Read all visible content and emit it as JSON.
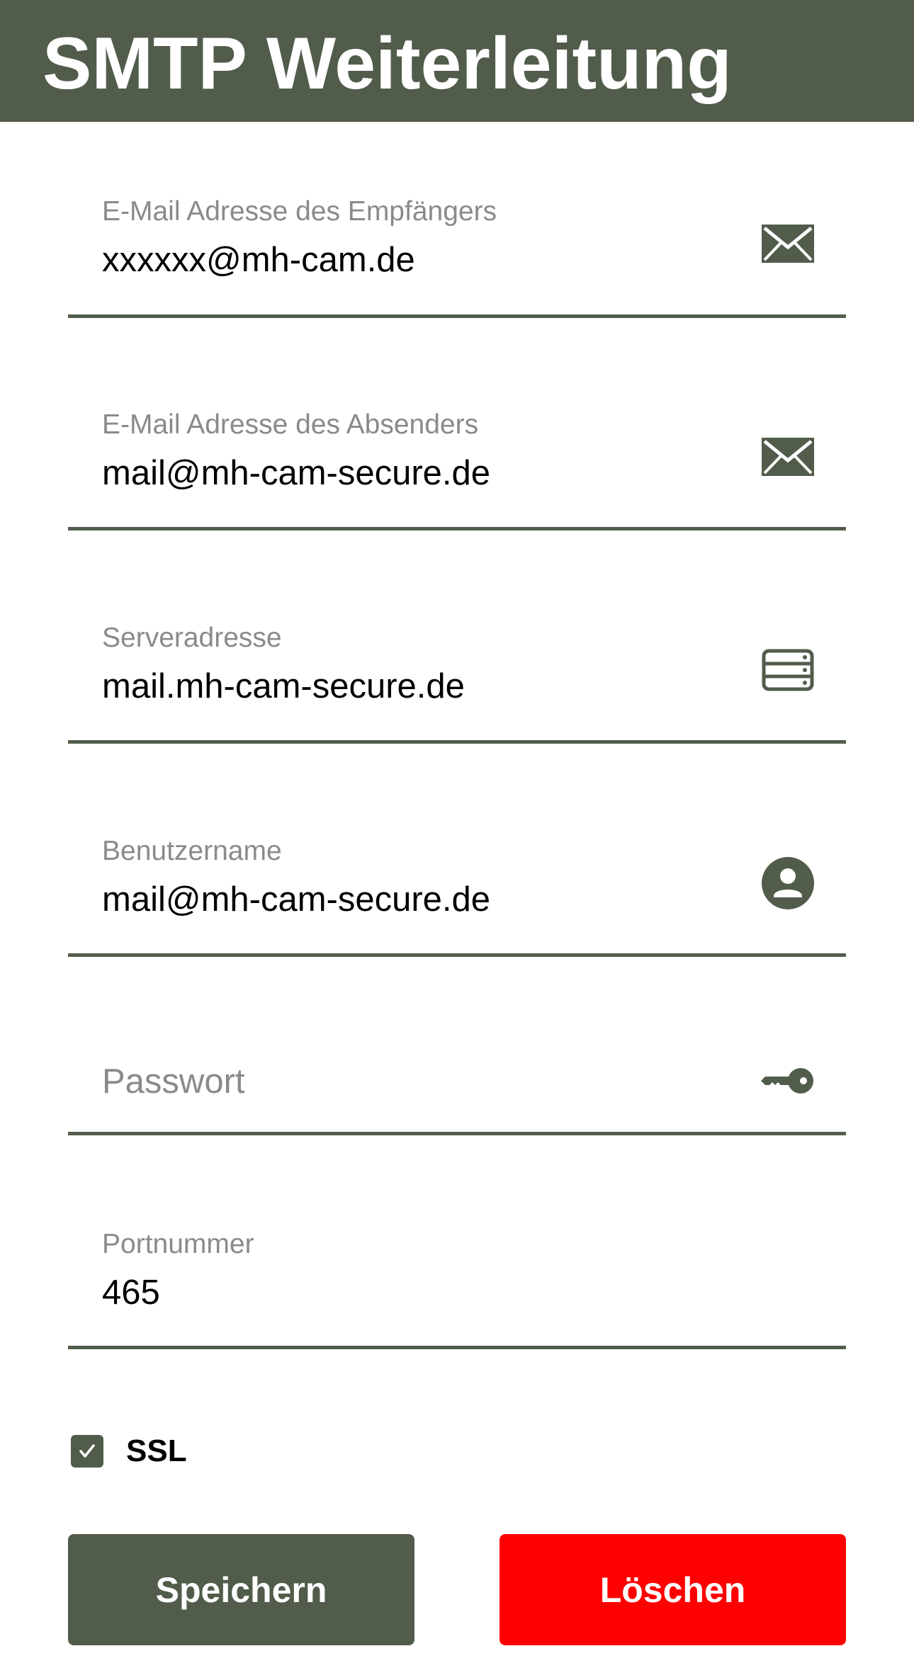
{
  "header": {
    "title": "SMTP Weiterleitung"
  },
  "fields": {
    "recipient": {
      "label": "E-Mail Adresse des Empfängers",
      "value": "xxxxxx@mh-cam.de",
      "icon": "envelope-icon"
    },
    "sender": {
      "label": "E-Mail Adresse des Absenders",
      "value": "mail@mh-cam-secure.de",
      "icon": "envelope-icon"
    },
    "server": {
      "label": "Serveradresse",
      "value": "mail.mh-cam-secure.de",
      "icon": "server-icon"
    },
    "username": {
      "label": "Benutzername",
      "value": "mail@mh-cam-secure.de",
      "icon": "user-icon"
    },
    "password": {
      "placeholder": "Passwort",
      "value": "",
      "icon": "key-icon"
    },
    "port": {
      "label": "Portnummer",
      "value": "465"
    }
  },
  "ssl": {
    "label": "SSL",
    "checked": true
  },
  "buttons": {
    "save_label": "Speichern",
    "delete_label": "Löschen"
  },
  "colors": {
    "accent": "#515c4b",
    "danger": "#ff0000",
    "label_gray": "#8a8a8a"
  }
}
